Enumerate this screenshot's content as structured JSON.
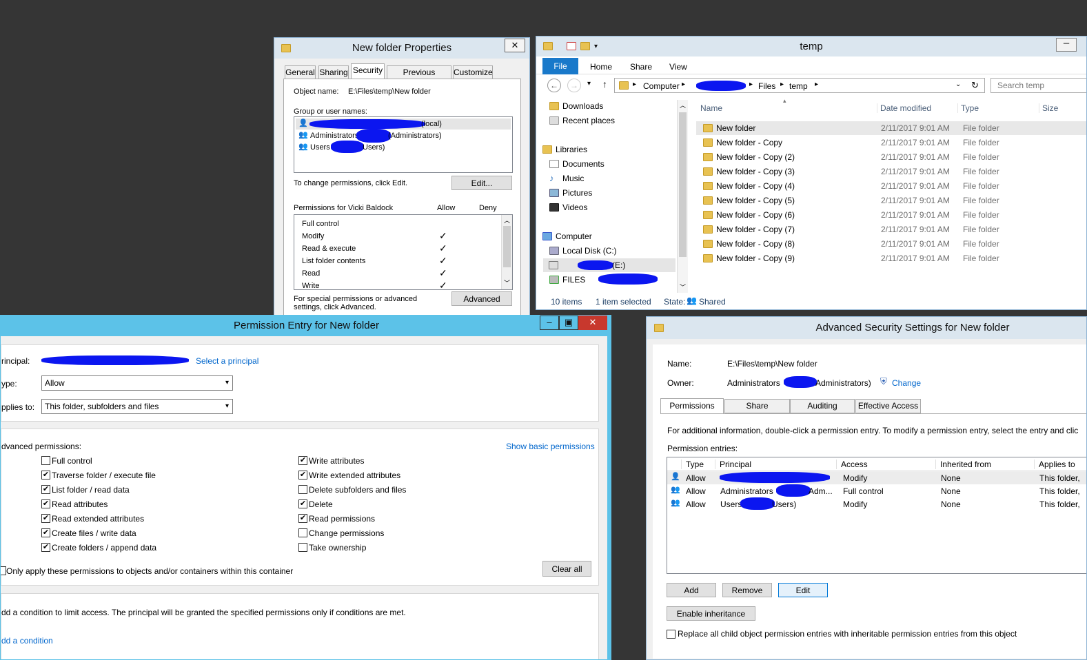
{
  "props": {
    "title": "New folder Properties",
    "tabs": [
      "General",
      "Sharing",
      "Security",
      "Previous Versions",
      "Customize"
    ],
    "object_label": "Object name:",
    "object_value": "E:\\Files\\temp\\New folder",
    "group_label": "Group or user names:",
    "users": [
      "(local)",
      "Administrators",
      "(Administrators)",
      "Users",
      "Users)"
    ],
    "change_text": "To change permissions, click Edit.",
    "edit_label": "Edit...",
    "perm_label": "Permissions for Vicki Baldock",
    "allow": "Allow",
    "deny": "Deny",
    "perms": [
      "Full control",
      "Modify",
      "Read & execute",
      "List folder contents",
      "Read",
      "Write"
    ],
    "special_text": "For special permissions or advanced settings, click Advanced.",
    "advanced_label": "Advanced",
    "close": "✕"
  },
  "explorer": {
    "title": "temp",
    "ribbon": [
      "File",
      "Home",
      "Share",
      "View"
    ],
    "crumbs": [
      "Computer",
      "Files",
      "temp"
    ],
    "search": "Search temp",
    "nav": [
      {
        "label": "Downloads"
      },
      {
        "label": "Recent places"
      },
      {
        "label": "Libraries"
      },
      {
        "label": "Documents"
      },
      {
        "label": "Music"
      },
      {
        "label": "Pictures"
      },
      {
        "label": "Videos"
      },
      {
        "label": "Computer"
      },
      {
        "label": "Local Disk (C:)"
      },
      {
        "label": "(E:)"
      },
      {
        "label": "FILES"
      }
    ],
    "cols": [
      "Name",
      "Date modified",
      "Type",
      "Size"
    ],
    "files": [
      "New folder",
      "New folder - Copy",
      "New folder - Copy (2)",
      "New folder - Copy (3)",
      "New folder - Copy (4)",
      "New folder - Copy (5)",
      "New folder - Copy (6)",
      "New folder - Copy (7)",
      "New folder - Copy (8)",
      "New folder - Copy (9)"
    ],
    "date": "2/11/2017 9:01 AM",
    "type": "File folder",
    "status_items": "10 items",
    "status_sel": "1 item selected",
    "status_state": "State:",
    "status_shared": "Shared"
  },
  "perm": {
    "title": "Permission Entry for New folder",
    "principal_label": "rincipal:",
    "select_principal": "Select a principal",
    "type_label": "ype:",
    "type_value": "Allow",
    "applies_label": "pplies to:",
    "applies_value": "This folder, subfolders and files",
    "adv_label": "dvanced permissions:",
    "show_basic": "Show basic permissions",
    "left": [
      {
        "label": "Full control",
        "checked": false
      },
      {
        "label": "Traverse folder / execute file",
        "checked": true
      },
      {
        "label": "List folder / read data",
        "checked": true
      },
      {
        "label": "Read attributes",
        "checked": true
      },
      {
        "label": "Read extended attributes",
        "checked": true
      },
      {
        "label": "Create files / write data",
        "checked": true
      },
      {
        "label": "Create folders / append data",
        "checked": true
      }
    ],
    "right": [
      {
        "label": "Write attributes",
        "checked": true
      },
      {
        "label": "Write extended attributes",
        "checked": true
      },
      {
        "label": "Delete subfolders and files",
        "checked": false
      },
      {
        "label": "Delete",
        "checked": true
      },
      {
        "label": "Read permissions",
        "checked": true
      },
      {
        "label": "Change permissions",
        "checked": false
      },
      {
        "label": "Take ownership",
        "checked": false
      }
    ],
    "only_apply": "Only apply these permissions to objects and/or containers within this container",
    "clear_all": "Clear all",
    "condition_text": "dd a condition to limit access. The principal will be granted the specified permissions only if conditions are met.",
    "add_condition": "dd a condition"
  },
  "adv": {
    "title": "Advanced Security Settings for New folder",
    "name_label": "Name:",
    "name_value": "E:\\Files\\temp\\New folder",
    "owner_label": "Owner:",
    "owner_value": "Administrators",
    "owner_suffix": "Administrators)",
    "change": "Change",
    "tabs": [
      "Permissions",
      "Share",
      "Auditing",
      "Effective Access"
    ],
    "info": "For additional information, double-click a permission entry. To modify a permission entry, select the entry and clic",
    "entries_label": "Permission entries:",
    "cols": [
      "Type",
      "Principal",
      "Access",
      "Inherited from",
      "Applies to"
    ],
    "rows": [
      {
        "type": "Allow",
        "principal": "",
        "access": "Modify",
        "inherited": "None",
        "applies": "This folder,"
      },
      {
        "type": "Allow",
        "principal": "Administrators",
        "suffix": "Adm...",
        "access": "Full control",
        "inherited": "None",
        "applies": "This folder,"
      },
      {
        "type": "Allow",
        "principal": "Users",
        "suffix": "Users)",
        "access": "Modify",
        "inherited": "None",
        "applies": "This folder,"
      }
    ],
    "add": "Add",
    "remove": "Remove",
    "edit": "Edit",
    "enable_inh": "Enable inheritance",
    "replace": "Replace all child object permission entries with inheritable permission entries from this object"
  }
}
